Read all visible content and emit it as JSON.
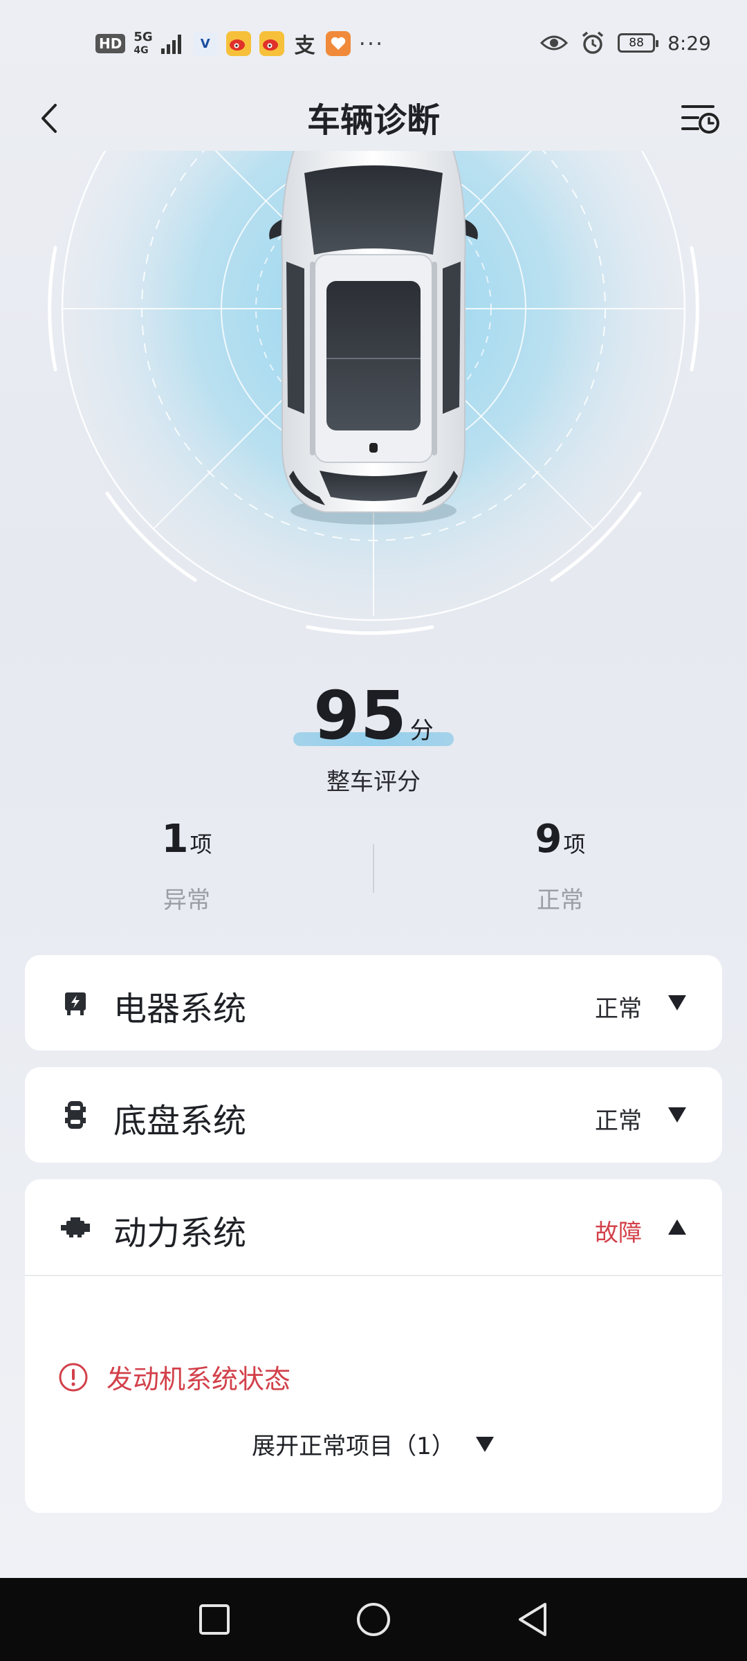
{
  "status_bar": {
    "hd": "HD",
    "network_top": "5G",
    "network_bottom": "4G",
    "apps": [
      "changan-app-icon",
      "weibo-icon",
      "weibo-icon",
      "alipay-icon",
      "health-app-icon"
    ],
    "more": "···",
    "battery": "88",
    "time": "8:29"
  },
  "header": {
    "title": "车辆诊断"
  },
  "score": {
    "value": "95",
    "unit": "分",
    "label": "整车评分"
  },
  "stats": {
    "abnormal": {
      "count": "1",
      "unit": "项",
      "label": "异常"
    },
    "normal": {
      "count": "9",
      "unit": "项",
      "label": "正常"
    }
  },
  "systems": [
    {
      "name": "电器系统",
      "status": "正常",
      "icon": "electrical-icon",
      "expanded": false
    },
    {
      "name": "底盘系统",
      "status": "正常",
      "icon": "chassis-icon",
      "expanded": false
    },
    {
      "name": "动力系统",
      "status": "故障",
      "icon": "engine-icon",
      "expanded": true
    }
  ],
  "power_detail": {
    "issue": "发动机系统状态",
    "expand_label": "展开正常项目（1）"
  },
  "colors": {
    "fault": "#d2404a",
    "radar_glow": "#a9dcf0",
    "nav_bar": "#0b0b0c"
  }
}
